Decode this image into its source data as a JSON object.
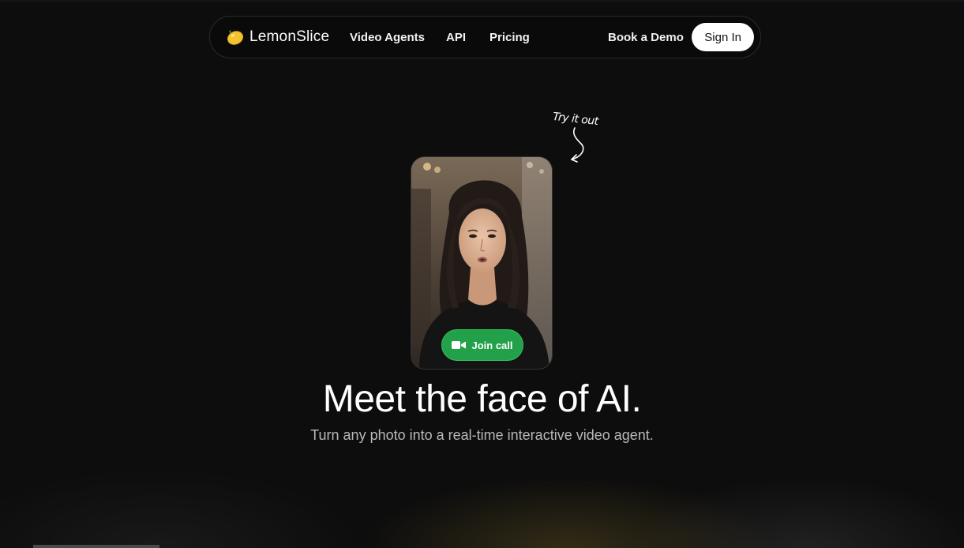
{
  "nav": {
    "brand": "LemonSlice",
    "links": [
      "Video Agents",
      "API",
      "Pricing"
    ],
    "book_demo": "Book a Demo",
    "sign_in": "Sign In"
  },
  "annotation": {
    "text": "Try it out"
  },
  "video_card": {
    "join_label": "Join call"
  },
  "hero": {
    "title": "Meet the face of AI.",
    "subtitle": "Turn any photo into a real-time interactive video agent."
  },
  "colors": {
    "background": "#0d0d0d",
    "join_green": "#22a04a",
    "sign_in_bg": "#ffffff",
    "lemon": "#f2c230"
  },
  "icons": [
    "lemon-icon",
    "hand-drawn-arrow-icon",
    "video-camera-icon"
  ]
}
